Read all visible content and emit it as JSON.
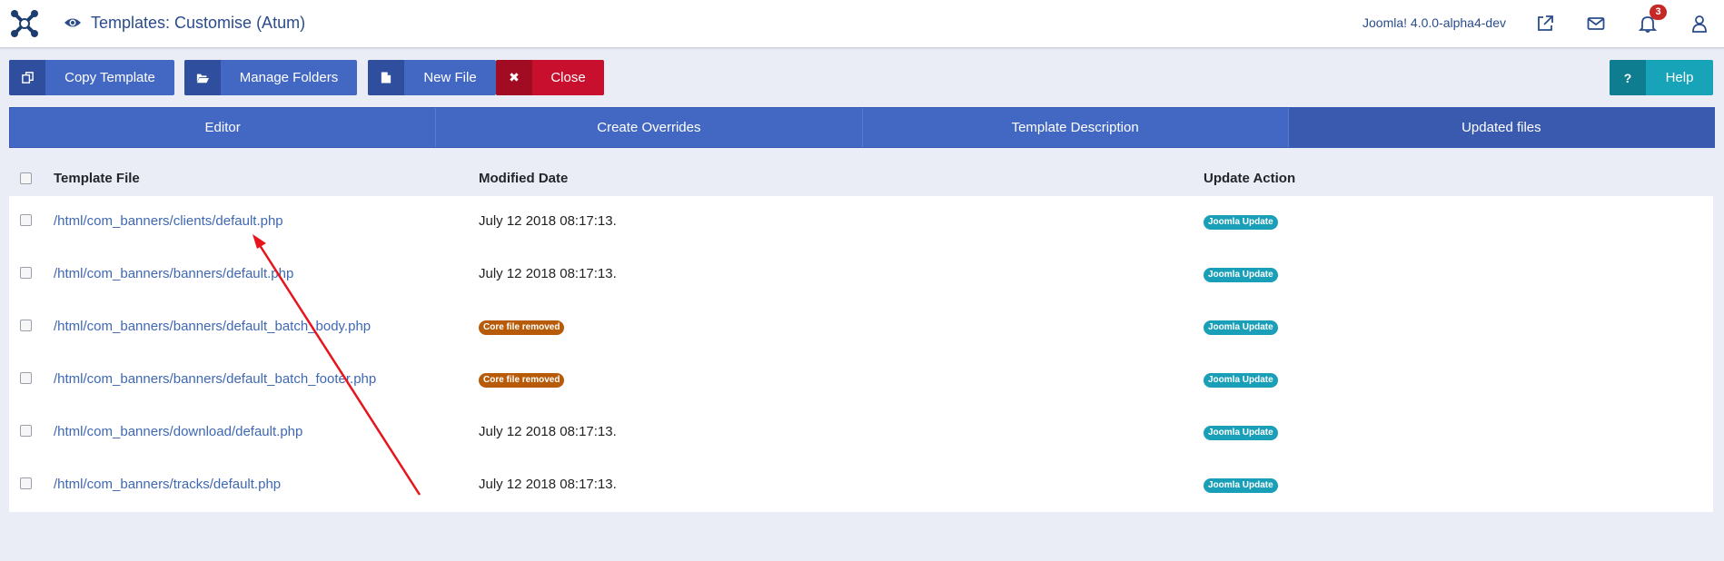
{
  "header": {
    "title": "Templates: Customise (Atum)",
    "version": "Joomla! 4.0.0-alpha4-dev",
    "notification_count": "3",
    "icons": [
      "joomla-logo-icon",
      "eye-icon",
      "external-link-icon",
      "envelope-icon",
      "bell-icon",
      "user-icon"
    ]
  },
  "toolbar": {
    "copy_template": "Copy Template",
    "manage_folders": "Manage Folders",
    "new_file": "New File",
    "close": "Close",
    "help": "Help",
    "help_icon_glyph": "?",
    "close_icon_glyph": "✖"
  },
  "tabs": [
    {
      "label": "Editor"
    },
    {
      "label": "Create Overrides"
    },
    {
      "label": "Template Description"
    },
    {
      "label": "Updated files",
      "active": true
    }
  ],
  "table": {
    "columns": [
      "Template File",
      "Modified Date",
      "Update Action"
    ],
    "rows": [
      {
        "file": "/html/com_banners/clients/default.php",
        "modified": "July 12 2018 08:17:13.",
        "action": "Joomla Update"
      },
      {
        "file": "/html/com_banners/banners/default.php",
        "modified": "July 12 2018 08:17:13.",
        "action": "Joomla Update"
      },
      {
        "file": "/html/com_banners/banners/default_batch_body.php",
        "modified": "Core file removed",
        "action": "Joomla Update"
      },
      {
        "file": "/html/com_banners/banners/default_batch_footer.php",
        "modified": "Core file removed",
        "action": "Joomla Update"
      },
      {
        "file": "/html/com_banners/download/default.php",
        "modified": "July 12 2018 08:17:13.",
        "action": "Joomla Update"
      },
      {
        "file": "/html/com_banners/tracks/default.php",
        "modified": "July 12 2018 08:17:13.",
        "action": "Joomla Update"
      }
    ]
  },
  "colors": {
    "primary": "#4368c4",
    "danger": "#c8102e",
    "info": "#17a3b8",
    "warning_badge": "#b75b08",
    "annotation_arrow": "#e8141b"
  }
}
